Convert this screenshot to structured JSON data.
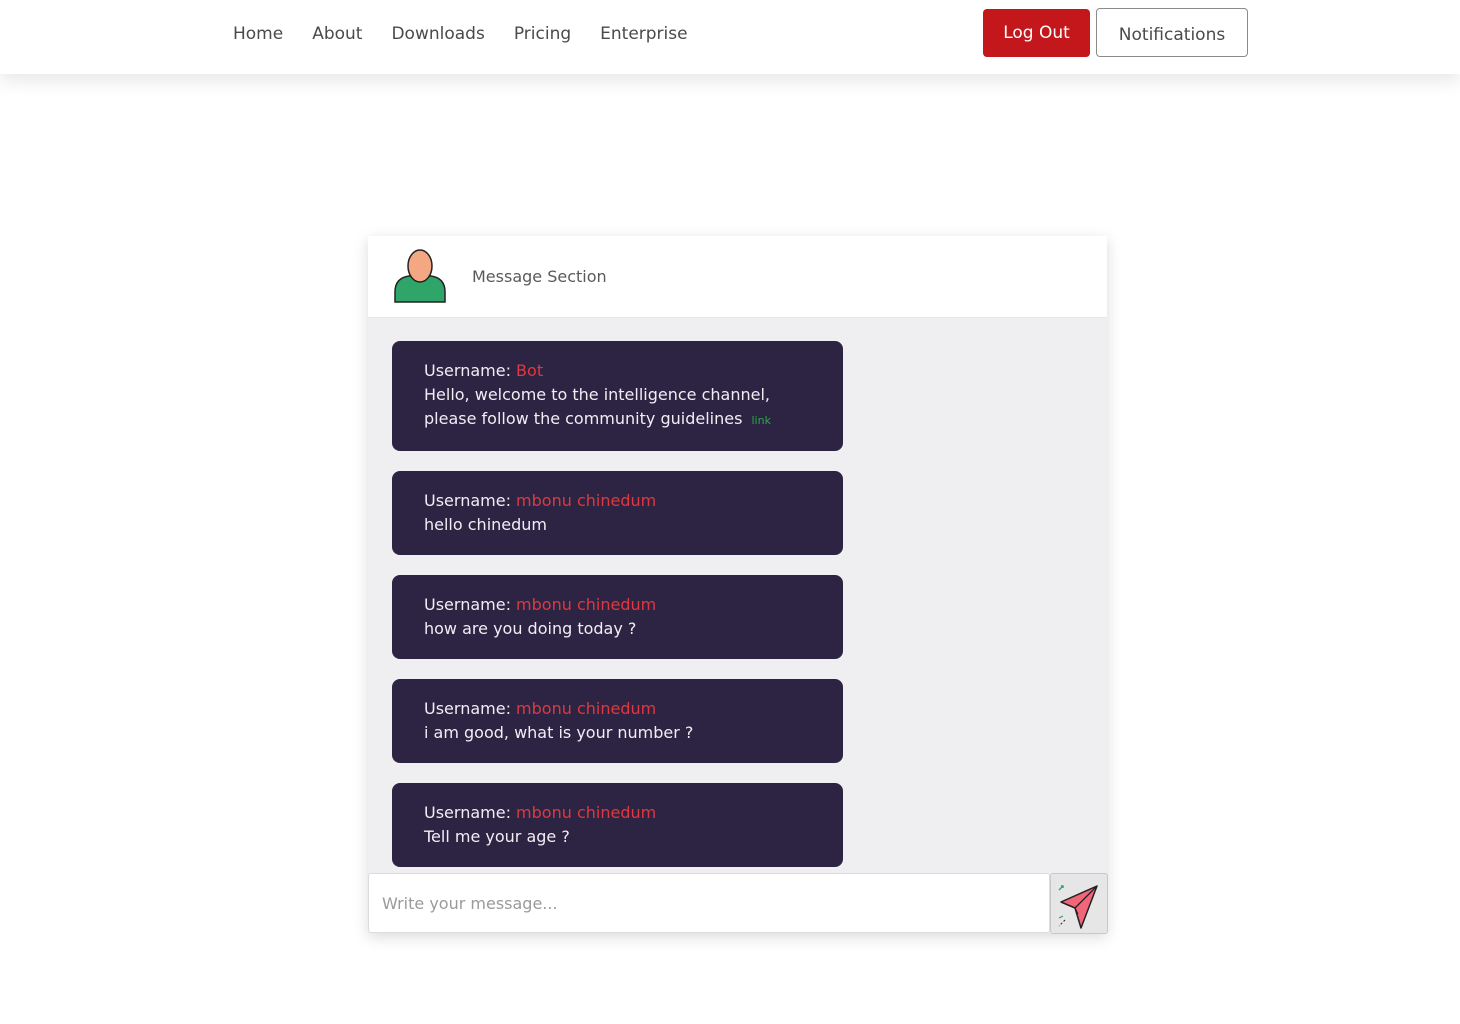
{
  "nav": {
    "links": [
      "Home",
      "About",
      "Downloads",
      "Pricing",
      "Enterprise"
    ],
    "logout_label": "Log Out",
    "notifications_label": "Notifications"
  },
  "chat": {
    "header_title": "Message Section",
    "username_prefix": "Username:",
    "messages": [
      {
        "username": "Bot",
        "text": "Hello, welcome to the intelligence channel, please follow the community guidelines",
        "link_label": "link"
      },
      {
        "username": "mbonu chinedum",
        "text": "hello chinedum"
      },
      {
        "username": "mbonu chinedum",
        "text": "how are you doing today ?"
      },
      {
        "username": "mbonu chinedum",
        "text": "i am good, what is your number ?"
      },
      {
        "username": "mbonu chinedum",
        "text": "Tell me your age ?"
      }
    ],
    "input_placeholder": "Write your message...",
    "input_value": ""
  },
  "icons": {
    "avatar": "user-avatar-icon",
    "send": "paper-plane-send-icon"
  },
  "colors": {
    "logout_bg": "#c4171c",
    "message_bg": "#2c2442",
    "username_color": "#e0383f",
    "link_color": "#2aa84a",
    "chat_bg": "#efeff2"
  }
}
